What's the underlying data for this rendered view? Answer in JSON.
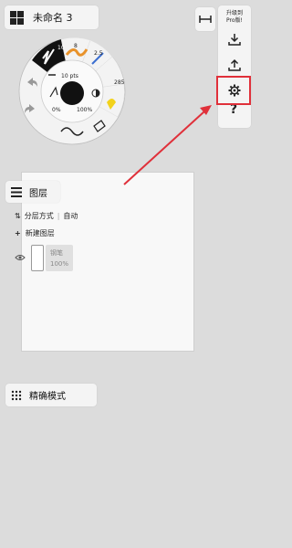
{
  "document": {
    "title": "未命名 3"
  },
  "right_toolbar": {
    "upgrade_line1": "升级到",
    "upgrade_line2": "Pro版!",
    "help_label": "?"
  },
  "tool_wheel": {
    "brush_sizes": [
      "10",
      "8",
      "2.5",
      "285"
    ],
    "size_value": "10 pts",
    "opacity_min": "0%",
    "opacity_max": "100%"
  },
  "layers": {
    "title": "图层",
    "split_mode_label": "分层方式",
    "split_mode_value": "自动",
    "new_layer_label": "新建图层",
    "layer_name": "钢笔",
    "layer_opacity": "100%"
  },
  "precision": {
    "label": "精确模式"
  },
  "colors": {
    "highlight": "#e0303a",
    "accent_yellow": "#f2d21b",
    "accent_orange": "#e8922a",
    "accent_blue": "#3b6fd0"
  }
}
